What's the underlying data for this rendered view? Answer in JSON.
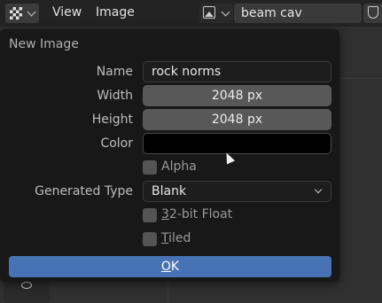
{
  "header": {
    "editor_type_icon": "image-editor-checker-icon",
    "menus": [
      "View",
      "Image"
    ],
    "browse_icon": "image-browse-icon",
    "image_name": "beam cav",
    "fake_user_icon": "shield-icon"
  },
  "dialog": {
    "title": "New Image",
    "name_label": "Name",
    "name_value": "rock norms",
    "width_label": "Width",
    "width_value": "2048 px",
    "height_label": "Height",
    "height_value": "2048 px",
    "color_label": "Color",
    "color_value": "#000000",
    "alpha_label": "Alpha",
    "alpha_checked": false,
    "generated_type_label": "Generated Type",
    "generated_type_value": "Blank",
    "float_label_underlined": "3",
    "float_label_rest": "2-bit Float",
    "float_checked": false,
    "tiled_label_underlined": "T",
    "tiled_label_rest": "iled",
    "tiled_checked": false,
    "ok_underlined": "O",
    "ok_rest": "K"
  },
  "colors": {
    "accent": "#4772b3",
    "dialog_bg": "#181818"
  }
}
